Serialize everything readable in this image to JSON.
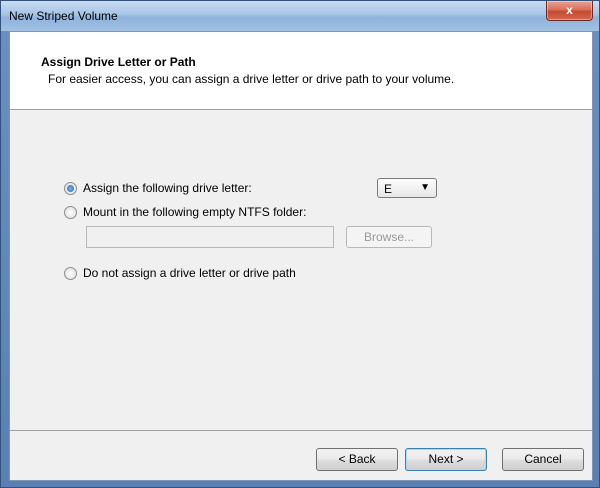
{
  "window": {
    "title": "New Striped Volume",
    "close_glyph": "x"
  },
  "header": {
    "title": "Assign Drive Letter or Path",
    "subtitle": "For easier access, you can assign a drive letter or drive path to your volume."
  },
  "options": {
    "assign_letter": {
      "label": "Assign the following drive letter:",
      "checked": true
    },
    "mount_folder": {
      "label": "Mount in the following empty NTFS folder:",
      "checked": false,
      "value": ""
    },
    "no_assign": {
      "label": "Do not assign a drive letter or drive path",
      "checked": false
    }
  },
  "drive_letter": {
    "selected": "E",
    "arrow_glyph": "▼"
  },
  "browse_label": "Browse...",
  "buttons": {
    "back": "< Back",
    "next": "Next >",
    "cancel": "Cancel"
  },
  "icons": {
    "close": "close-icon",
    "dropdown": "chevron-down-icon"
  }
}
